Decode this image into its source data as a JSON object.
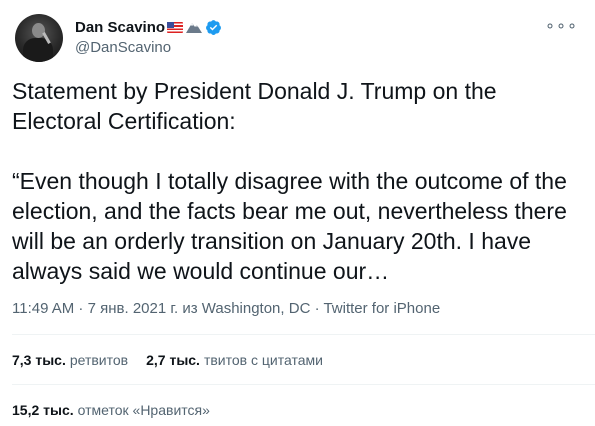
{
  "author": {
    "display_name": "Dan Scavino",
    "handle": "@DanScavino",
    "emoji": [
      "flag-us",
      "mountain-snow"
    ],
    "verified_color": "#1d9bf0"
  },
  "tweet": {
    "text": "Statement by President Donald J. Trump on the Electoral Certification:\n\n“Even though I totally disagree with the outcome of the election, and the facts bear me out, nevertheless there will be an orderly transition on January 20th. I have always said we would continue our…",
    "meta": "11:49 AM · 7 янв. 2021 г. из Washington, DC · Twitter for iPhone"
  },
  "stats": {
    "retweets_num": "7,3 тыс.",
    "retweets_label": "ретвитов",
    "quotes_num": "2,7 тыс.",
    "quotes_label": "твитов с цитатами",
    "likes_num": "15,2 тыс.",
    "likes_label": "отметок «Нравится»"
  },
  "more_menu": "∘∘∘"
}
